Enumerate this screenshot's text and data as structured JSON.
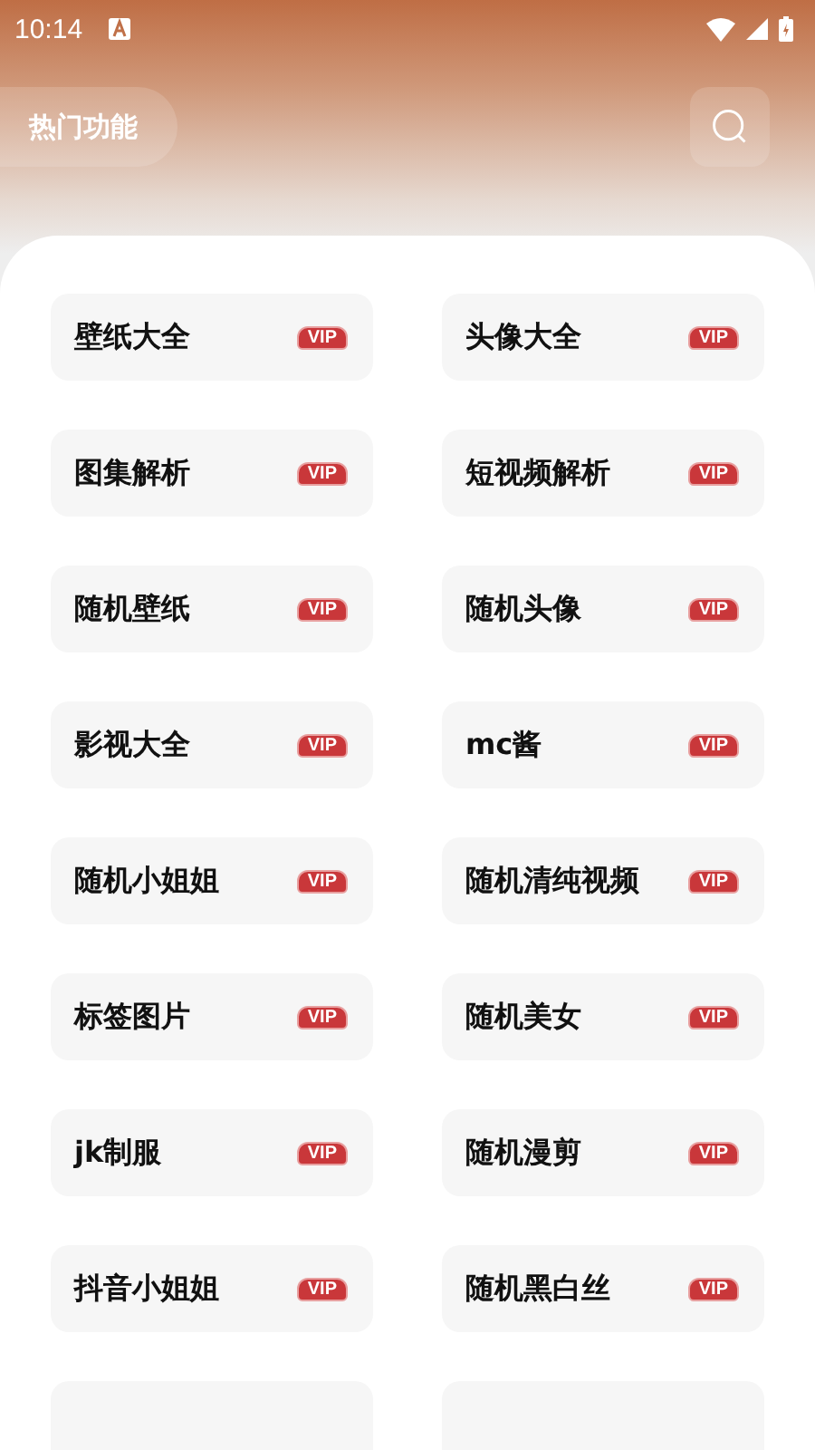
{
  "status_bar": {
    "time": "10:14"
  },
  "header": {
    "title": "热门功能"
  },
  "items": [
    {
      "label": "壁纸大全",
      "badge": "VIP"
    },
    {
      "label": "头像大全",
      "badge": "VIP"
    },
    {
      "label": "图集解析",
      "badge": "VIP"
    },
    {
      "label": "短视频解析",
      "badge": "VIP"
    },
    {
      "label": "随机壁纸",
      "badge": "VIP"
    },
    {
      "label": "随机头像",
      "badge": "VIP"
    },
    {
      "label": "影视大全",
      "badge": "VIP"
    },
    {
      "label": "mc酱",
      "badge": "VIP"
    },
    {
      "label": "随机小姐姐",
      "badge": "VIP"
    },
    {
      "label": "随机清纯视频",
      "badge": "VIP"
    },
    {
      "label": "标签图片",
      "badge": "VIP"
    },
    {
      "label": "随机美女",
      "badge": "VIP"
    },
    {
      "label": "jk制服",
      "badge": "VIP"
    },
    {
      "label": "随机漫剪",
      "badge": "VIP"
    },
    {
      "label": "抖音小姐姐",
      "badge": "VIP"
    },
    {
      "label": "随机黑白丝",
      "badge": "VIP"
    }
  ]
}
